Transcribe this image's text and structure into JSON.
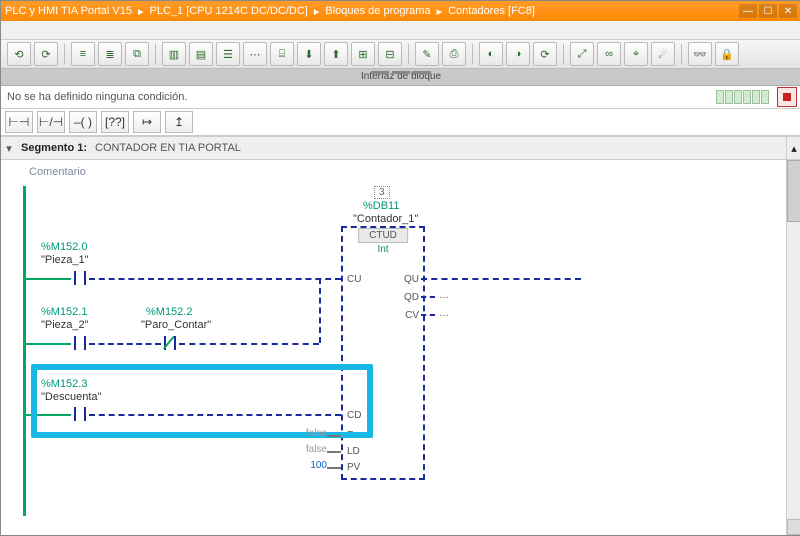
{
  "titlebar": {
    "crumbs": [
      "PLC y HMI TIA Portal V15",
      "PLC_1 [CPU 1214C DC/DC/DC]",
      "Bloques de programa",
      "Contadores [FC8]"
    ]
  },
  "interfaceBar": {
    "label": "Interfaz de bloque"
  },
  "condition": {
    "text": "No se ha definido ninguna condición."
  },
  "segment": {
    "name": "Segmento 1:",
    "title": "CONTADOR EN TIA PORTAL",
    "comment": "Comentario"
  },
  "db": {
    "index": "3",
    "address": "%DB11",
    "name": "\"Contador_1\""
  },
  "block": {
    "type": "CTUD",
    "dtype": "Int",
    "pinsLeft": [
      "CU",
      "CD",
      "R",
      "LD",
      "PV"
    ],
    "pinsRight": [
      "QU",
      "QD",
      "CV"
    ],
    "paramR": "false",
    "paramLD": "false",
    "paramPV": "100"
  },
  "nets": {
    "n1": {
      "addr": "%M152.0",
      "name": "\"Pieza_1\""
    },
    "n2a": {
      "addr": "%M152.1",
      "name": "\"Pieza_2\""
    },
    "n2b": {
      "addr": "%M152.2",
      "name": "\"Paro_Contar\""
    },
    "n3": {
      "addr": "%M152.3",
      "name": "\"Descuenta\""
    }
  }
}
